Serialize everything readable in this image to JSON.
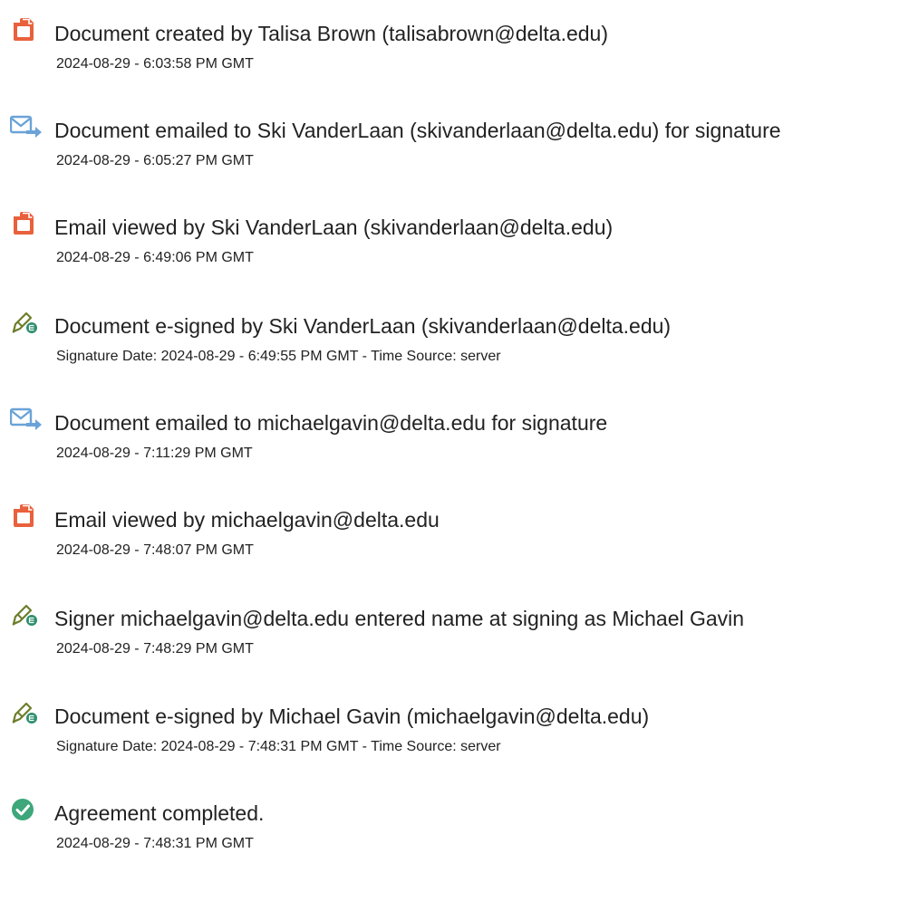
{
  "colors": {
    "doc_icon": "#E8613C",
    "email_icon": "#6AA3D8",
    "sign_icon_outline": "#6B7E2A",
    "sign_icon_badge": "#2E8F6D",
    "complete_icon": "#3DA67A",
    "text": "#222222"
  },
  "events": [
    {
      "icon": "document-icon",
      "title": "Document created by Talisa Brown (talisabrown@delta.edu)",
      "meta": "2024-08-29 - 6:03:58 PM GMT"
    },
    {
      "icon": "email-sent-icon",
      "title": "Document emailed to Ski VanderLaan (skivanderlaan@delta.edu) for signature",
      "meta": "2024-08-29 - 6:05:27 PM GMT"
    },
    {
      "icon": "document-icon",
      "title": "Email viewed by Ski VanderLaan (skivanderlaan@delta.edu)",
      "meta": "2024-08-29 - 6:49:06 PM GMT"
    },
    {
      "icon": "e-sign-icon",
      "title": "Document e-signed by Ski VanderLaan (skivanderlaan@delta.edu)",
      "meta": "Signature Date: 2024-08-29 - 6:49:55 PM GMT - Time Source: server"
    },
    {
      "icon": "email-sent-icon",
      "title": "Document emailed to michaelgavin@delta.edu for signature",
      "meta": "2024-08-29 - 7:11:29 PM GMT"
    },
    {
      "icon": "document-icon",
      "title": "Email viewed by michaelgavin@delta.edu",
      "meta": "2024-08-29 - 7:48:07 PM GMT"
    },
    {
      "icon": "e-sign-icon",
      "title": "Signer michaelgavin@delta.edu entered name at signing as Michael Gavin",
      "meta": "2024-08-29 - 7:48:29 PM GMT"
    },
    {
      "icon": "e-sign-icon",
      "title": "Document e-signed by Michael Gavin (michaelgavin@delta.edu)",
      "meta": "Signature Date: 2024-08-29 - 7:48:31 PM GMT - Time Source: server"
    },
    {
      "icon": "checkmark-circle-icon",
      "title": "Agreement completed.",
      "meta": "2024-08-29 - 7:48:31 PM GMT"
    }
  ]
}
